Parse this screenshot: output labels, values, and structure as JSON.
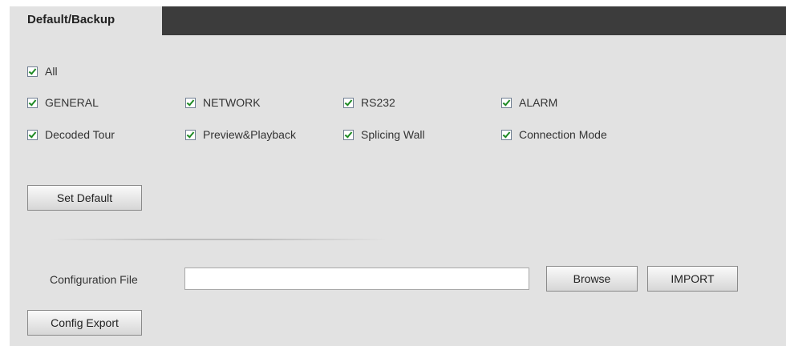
{
  "tab": {
    "title": "Default/Backup"
  },
  "checkboxes": {
    "all": {
      "label": "All",
      "checked": true
    },
    "general": {
      "label": "GENERAL",
      "checked": true
    },
    "network": {
      "label": "NETWORK",
      "checked": true
    },
    "rs232": {
      "label": "RS232",
      "checked": true
    },
    "alarm": {
      "label": "ALARM",
      "checked": true
    },
    "decoded_tour": {
      "label": "Decoded Tour",
      "checked": true
    },
    "preview_playback": {
      "label": "Preview&Playback",
      "checked": true
    },
    "splicing_wall": {
      "label": "Splicing Wall",
      "checked": true
    },
    "connection_mode": {
      "label": "Connection Mode",
      "checked": true
    }
  },
  "buttons": {
    "set_default": "Set Default",
    "browse": "Browse",
    "import": "IMPORT",
    "config_export": "Config Export"
  },
  "config_file": {
    "label": "Configuration File",
    "value": "",
    "placeholder": ""
  },
  "colors": {
    "tab_bar": "#3c3c3c",
    "panel_bg": "#e2e2e2",
    "checkmark": "#1e8a24"
  }
}
